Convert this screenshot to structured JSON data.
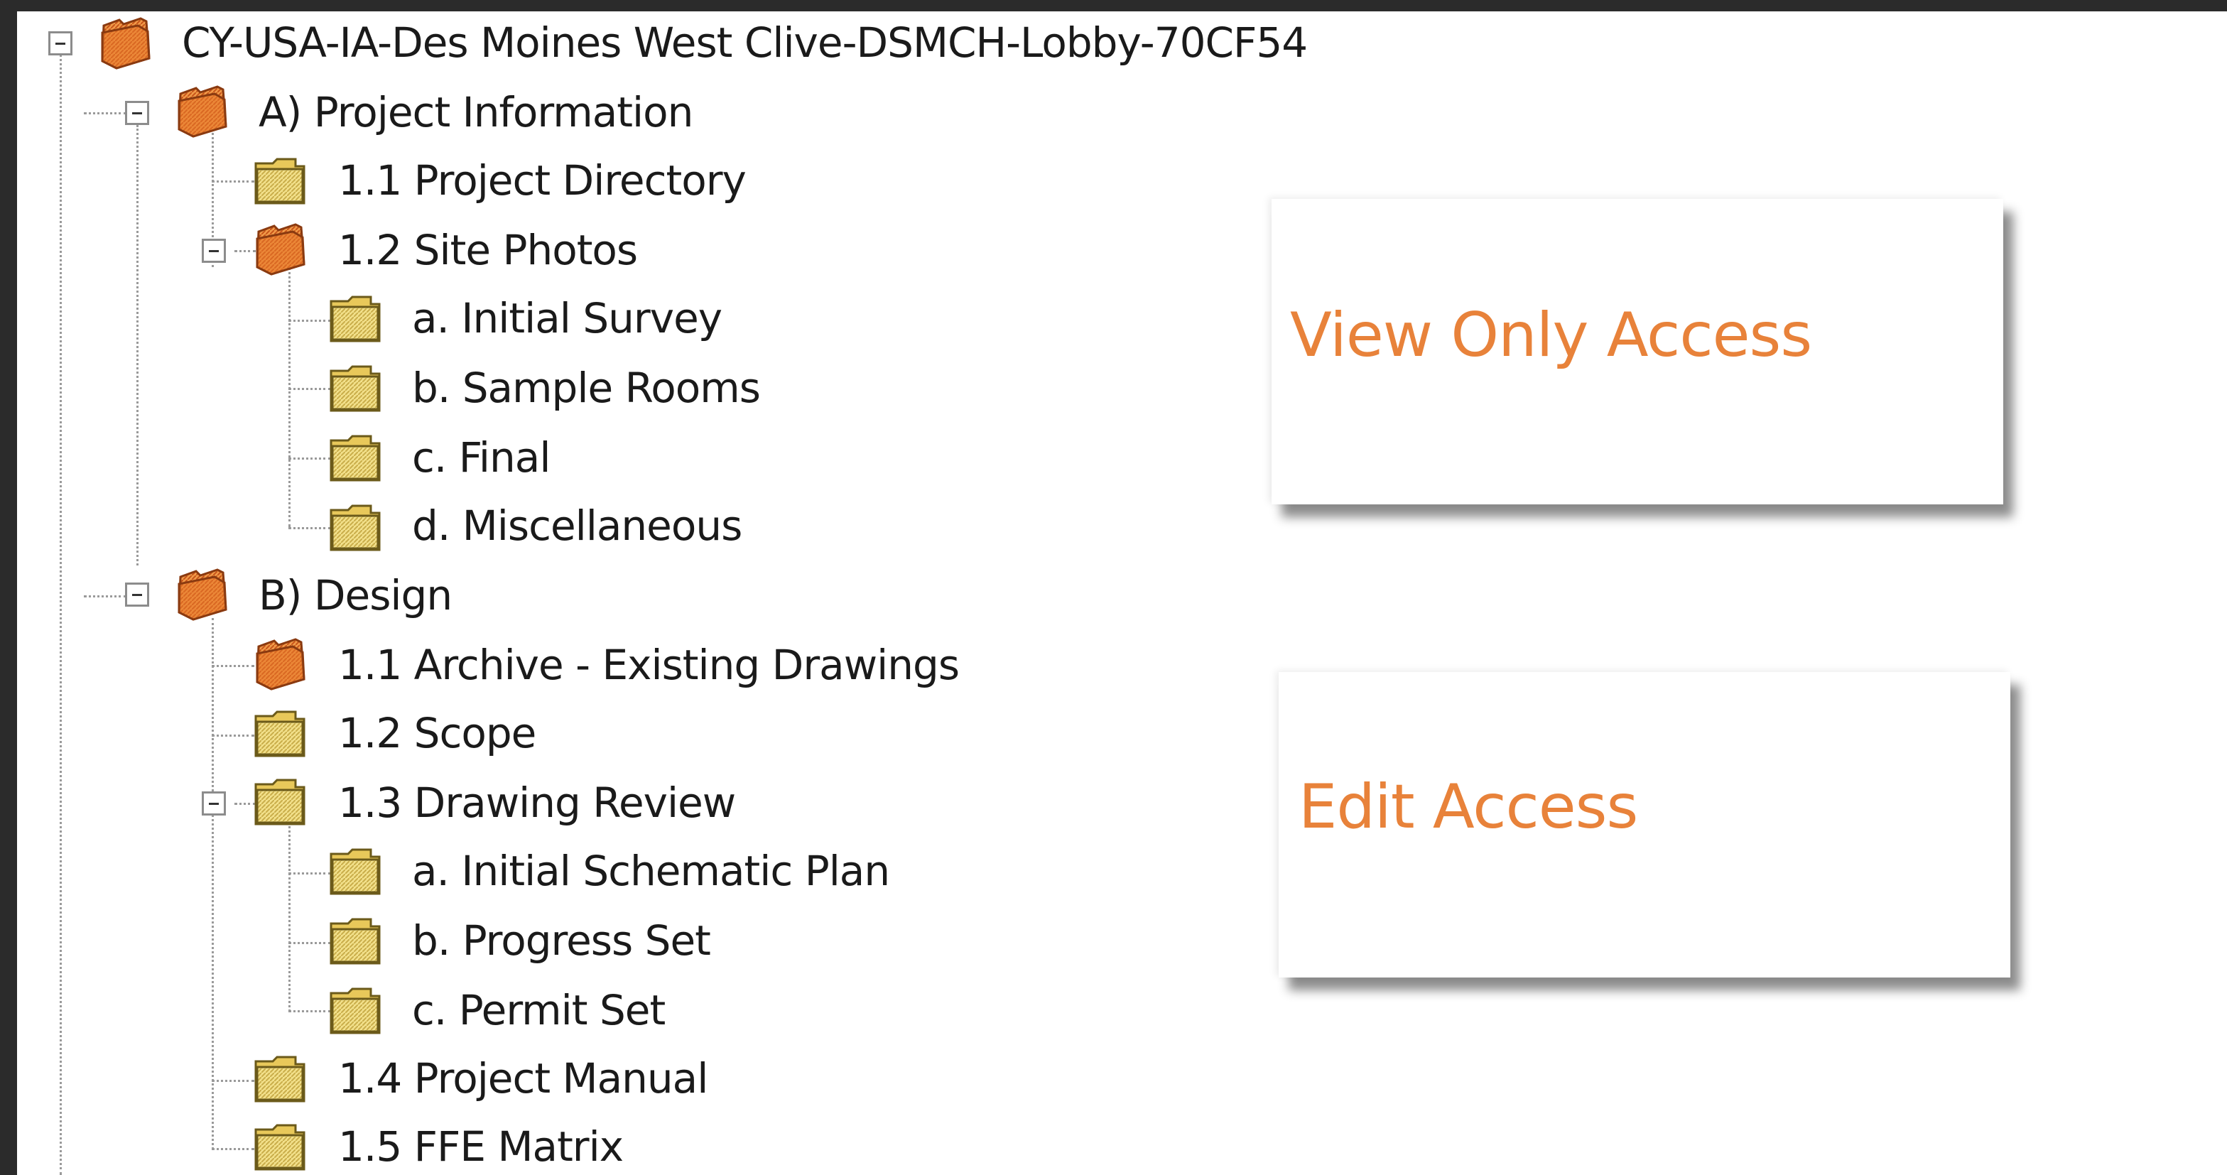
{
  "tree": {
    "root": {
      "label": "CY-USA-IA-Des Moines West Clive-DSMCH-Lobby-70CF54"
    },
    "project_information": {
      "label": "A) Project Information",
      "project_directory": "1.1 Project Directory",
      "site_photos": {
        "label": "1.2 Site Photos",
        "initial_survey": "a. Initial Survey",
        "sample_rooms": "b. Sample Rooms",
        "final": "c. Final",
        "miscellaneous": "d. Miscellaneous"
      }
    },
    "design": {
      "label": "B) Design",
      "archive": "1.1 Archive - Existing Drawings",
      "scope": "1.2 Scope",
      "drawing_review": {
        "label": "1.3 Drawing Review",
        "initial_schematic_plan": "a. Initial Schematic Plan",
        "progress_set": "b. Progress Set",
        "permit_set": "c. Permit Set"
      },
      "project_manual": "1.4 Project Manual",
      "ffe_matrix": "1.5 FFE Matrix"
    }
  },
  "callouts": {
    "view_only": "View Only Access",
    "edit": "Edit Access"
  },
  "colors": {
    "restricted_folder": "#e8782a",
    "open_folder": "#e8d27a",
    "callout_text": "#e8823a",
    "background": "#2b2b2b"
  }
}
